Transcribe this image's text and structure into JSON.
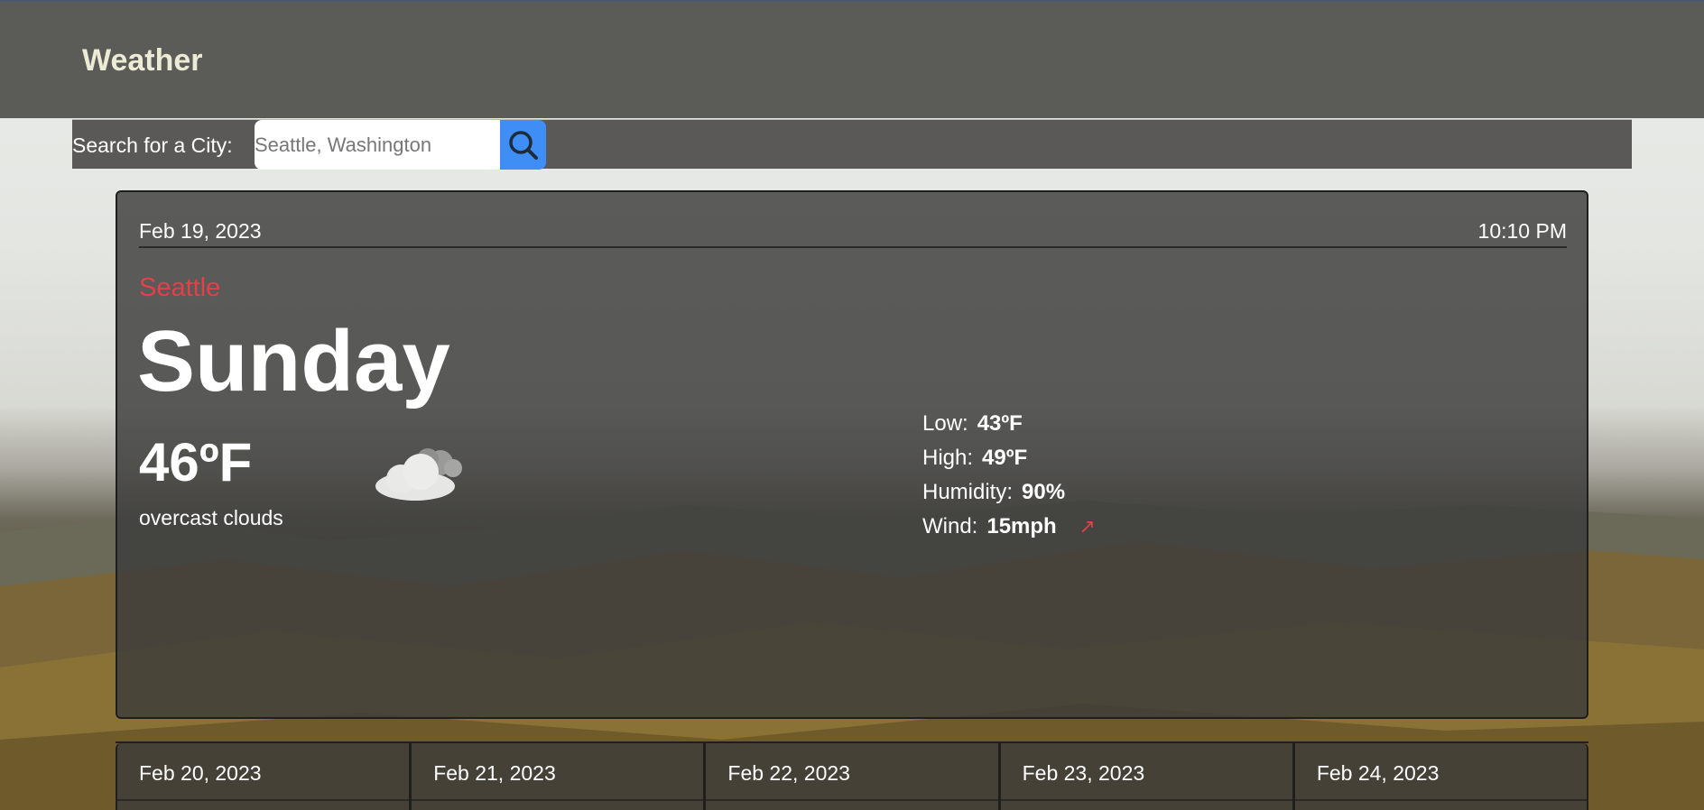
{
  "app": {
    "title": "Weather"
  },
  "search": {
    "label": "Search for a City:",
    "placeholder": "Seattle, Washington"
  },
  "current": {
    "date": "Feb 19, 2023",
    "time": "10:10 PM",
    "city": "Seattle",
    "day": "Sunday",
    "temp": "46ºF",
    "description": "overcast clouds",
    "weather_icon": "overcast-cloud-icon",
    "stats": [
      {
        "label": "Low:",
        "value": "43ºF"
      },
      {
        "label": "High:",
        "value": "49ºF"
      },
      {
        "label": "Humidity:",
        "value": "90%"
      },
      {
        "label": "Wind:",
        "value": "15mph"
      }
    ],
    "wind_icon": "wind-direction-arrow-icon"
  },
  "forecast": [
    {
      "date": "Feb 20, 2023"
    },
    {
      "date": "Feb 21, 2023"
    },
    {
      "date": "Feb 22, 2023"
    },
    {
      "date": "Feb 23, 2023"
    },
    {
      "date": "Feb 24, 2023"
    }
  ],
  "colors": {
    "accent": "#3f8ef5",
    "city": "#e0414a",
    "brand": "#ecebd6"
  }
}
